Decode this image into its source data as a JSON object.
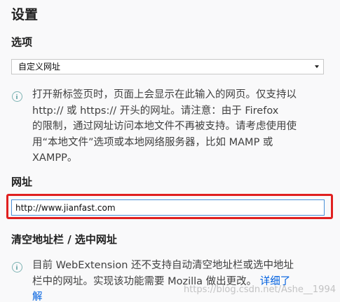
{
  "page": {
    "title": "设置"
  },
  "options": {
    "label": "选项",
    "select_value": "自定义网址",
    "info_line1": "打开新标签页时，页面上会显示在此输入的网页。仅支持以",
    "info_line2": "http:// 或 https:// 开头的网址。请注意：由于 Firefox",
    "info_line3": "的限制，通过网址访问本地文件不再被支持。请考虑使用使",
    "info_line4": "用“本地文件”选项或本地网络服务器，比如 MAMP 或",
    "info_line5": "XAMPP。"
  },
  "url": {
    "label": "网址",
    "value": "http://www.jianfast.com"
  },
  "clear": {
    "label": "清空地址栏 / 选中网址",
    "info_line1": "目前 WebExtension 还不支持自动清空地址栏或选中地址",
    "info_line2": "栏中的网址。实现该功能需要 Mozilla 做出更改。",
    "learn_more_part1": "详细了",
    "learn_more_part2": "解"
  },
  "watermark": "https://blog.csdn.net/Ashe__1994",
  "colors": {
    "highlight_border": "#e02020",
    "link": "#0060df",
    "info_icon": "#7fb4b4"
  }
}
